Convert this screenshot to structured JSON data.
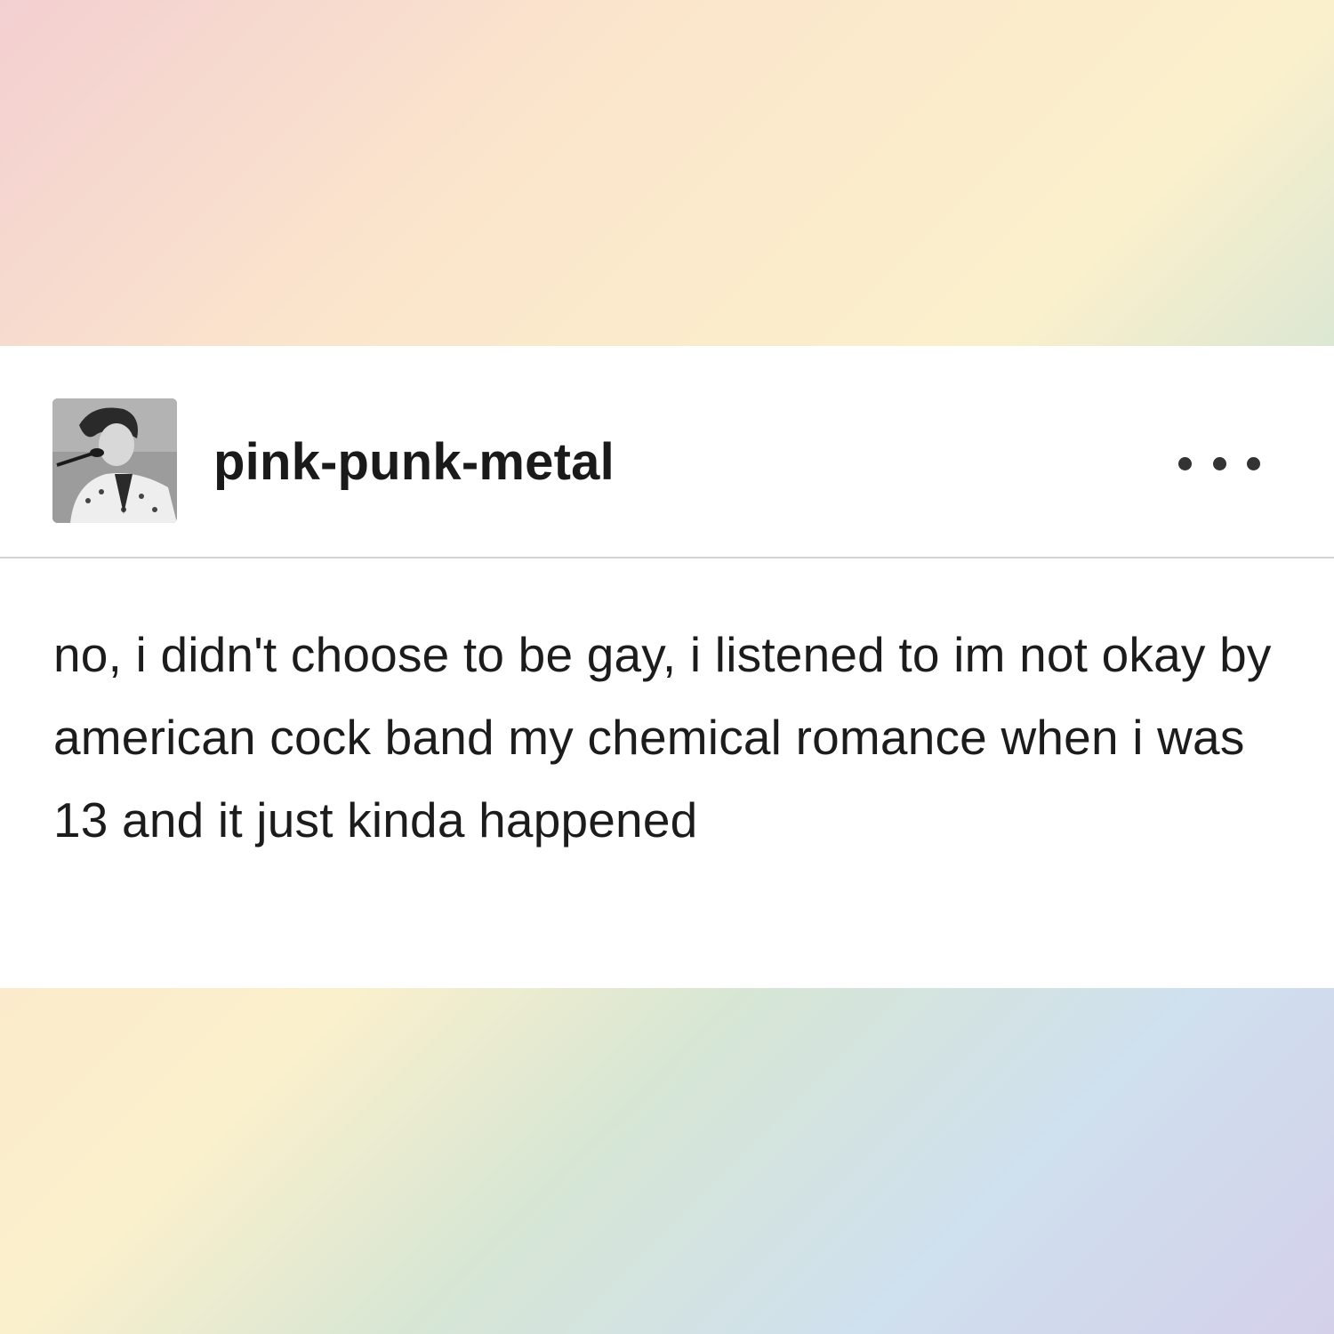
{
  "post": {
    "username": "pink-punk-metal",
    "avatar_icon": "avatar-photo-icon",
    "more_icon": "more-options-icon",
    "body": "no, i didn't choose to be gay, i listened to im not okay by american cock band my chemical romance when i was 13 and it just kinda happened"
  }
}
